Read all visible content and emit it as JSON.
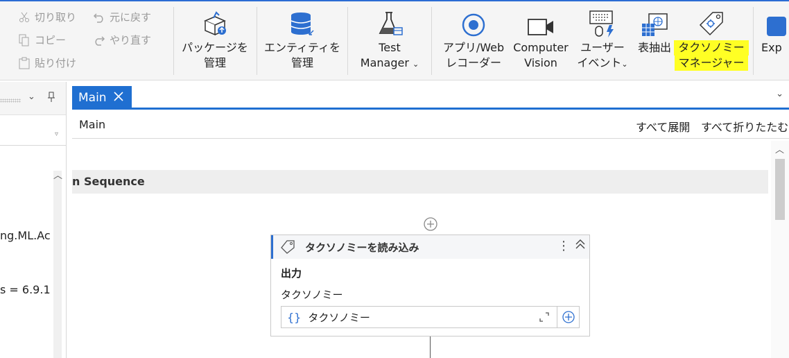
{
  "ribbon": {
    "clipboard": {
      "cut": "切り取り",
      "undo": "元に戻す",
      "copy": "コピー",
      "redo": "やり直す",
      "paste": "貼り付け"
    },
    "buttons": [
      {
        "line1": "パッケージを",
        "line2": "管理"
      },
      {
        "line1": "エンティティを",
        "line2": "管理"
      },
      {
        "line1": "Test",
        "line2": "Manager"
      },
      {
        "line1": "アプリ/Web",
        "line2": "レコーダー"
      },
      {
        "line1": "Computer",
        "line2": "Vision"
      },
      {
        "line1": "ユーザー",
        "line2": "イベント"
      },
      {
        "line1": "表抽出",
        "line2": ""
      },
      {
        "line1": "タクソノミー",
        "line2": "マネージャー"
      },
      {
        "line1": "",
        "line2": "Exp"
      }
    ]
  },
  "left_panel": {
    "line1": "ng.ML.Ac",
    "line2": "s = 6.9.1"
  },
  "document": {
    "tab_title": "Main",
    "breadcrumb": "Main",
    "expand_all": "すべて展開",
    "collapse_all": "すべて折りたたむ",
    "sequence_label": "n Sequence"
  },
  "activity": {
    "title": "タクソノミーを読み込み",
    "output_label": "出力",
    "taxonomy_label": "タクソノミー",
    "taxonomy_value": "タクソノミー"
  },
  "colors": {
    "accent": "#1f6fd1",
    "highlight": "#ffff24"
  }
}
